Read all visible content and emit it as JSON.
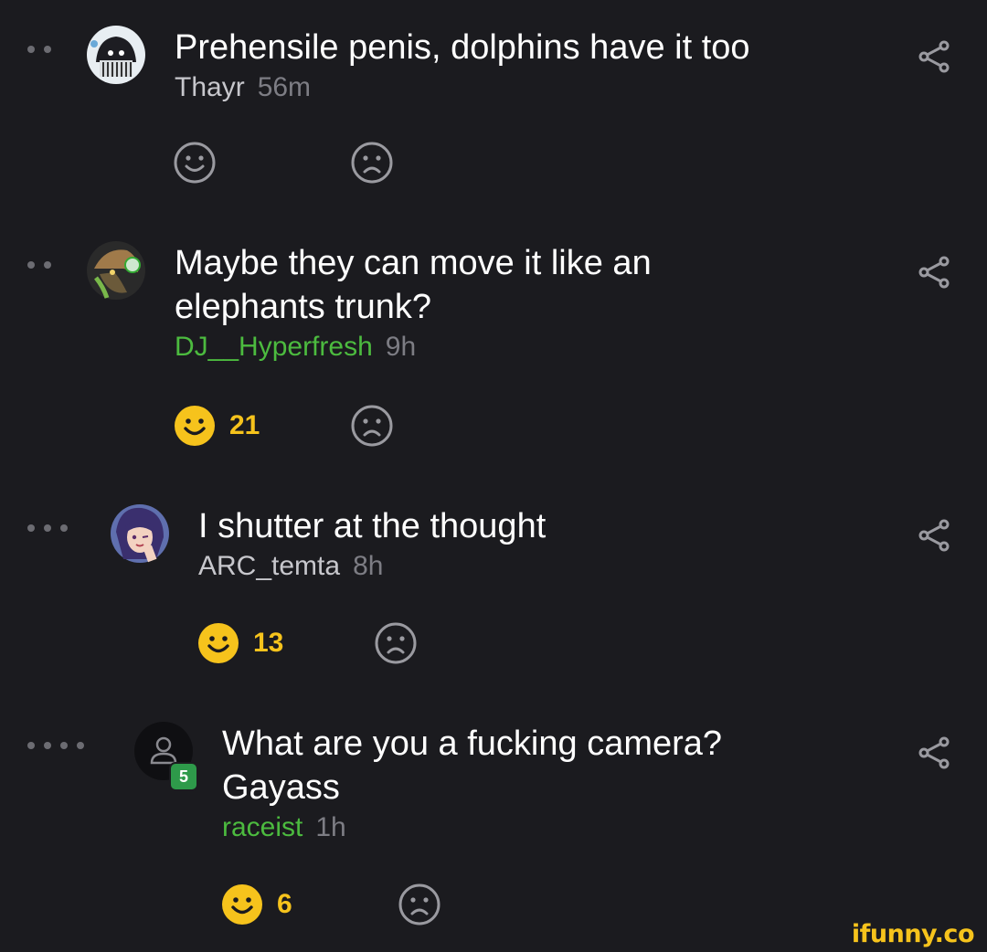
{
  "comments": [
    {
      "text_lines": [
        "Prehensile penis, dolphins have it too"
      ],
      "author": "Thayr",
      "time": "56m",
      "likes": "",
      "depth_dots": 2,
      "avatar_icon": "masked-character-avatar"
    },
    {
      "text_lines": [
        "Maybe they can move it like an",
        "elephants trunk?"
      ],
      "author": "DJ__Hyperfresh",
      "time": "9h",
      "likes": "21",
      "depth_dots": 2,
      "avatar_icon": "splatoon-character-avatar"
    },
    {
      "text_lines": [
        "I shutter at the thought"
      ],
      "author": "ARC_temta",
      "time": "8h",
      "likes": "13",
      "depth_dots": 3,
      "avatar_icon": "anime-character-avatar"
    },
    {
      "text_lines": [
        "What are you a fucking camera?",
        "Gayass"
      ],
      "author": "raceist",
      "time": "1h",
      "likes": "6",
      "level_badge": "5",
      "depth_dots": 4,
      "avatar_icon": "default-user-avatar"
    }
  ],
  "watermark": "ifunny.co",
  "colors": {
    "background": "#1b1b1f",
    "text": "#ffffff",
    "author_green": "#4cbb3f",
    "timestamp": "#7d7d84",
    "like_yellow": "#f6c31c",
    "icon_gray": "#9a9aa0"
  }
}
